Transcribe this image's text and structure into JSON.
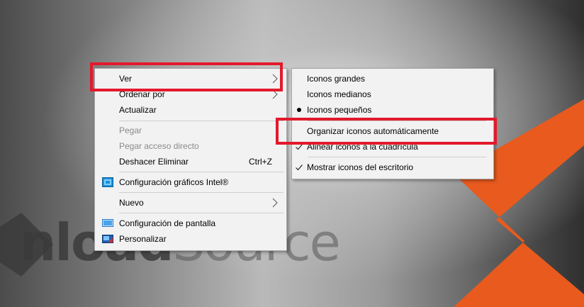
{
  "context_menu": {
    "items": [
      {
        "label": "Ver"
      },
      {
        "label": "Ordenar por"
      },
      {
        "label": "Actualizar"
      },
      {
        "label": "Pegar"
      },
      {
        "label": "Pegar acceso directo"
      },
      {
        "label": "Deshacer Eliminar",
        "shortcut": "Ctrl+Z"
      },
      {
        "label": "Configuración gráficos Intel®"
      },
      {
        "label": "Nuevo"
      },
      {
        "label": "Configuración de pantalla"
      },
      {
        "label": "Personalizar"
      }
    ]
  },
  "view_submenu": {
    "items": [
      {
        "label": "Iconos grandes"
      },
      {
        "label": "Iconos medianos"
      },
      {
        "label": "Iconos pequeños",
        "selected": true
      },
      {
        "label": "Organizar iconos automáticamente",
        "checked": false
      },
      {
        "label": "Alinear iconos a la cuadrícula",
        "checked": true
      },
      {
        "label": "Mostrar iconos del escritorio",
        "checked": true
      }
    ]
  },
  "wallpaper": {
    "brand_text_a": "nload",
    "brand_text_b": "Source"
  },
  "colors": {
    "highlight": "#e3192c",
    "brand_orange": "#e85a1e",
    "menu_bg": "#f2f2f2"
  }
}
